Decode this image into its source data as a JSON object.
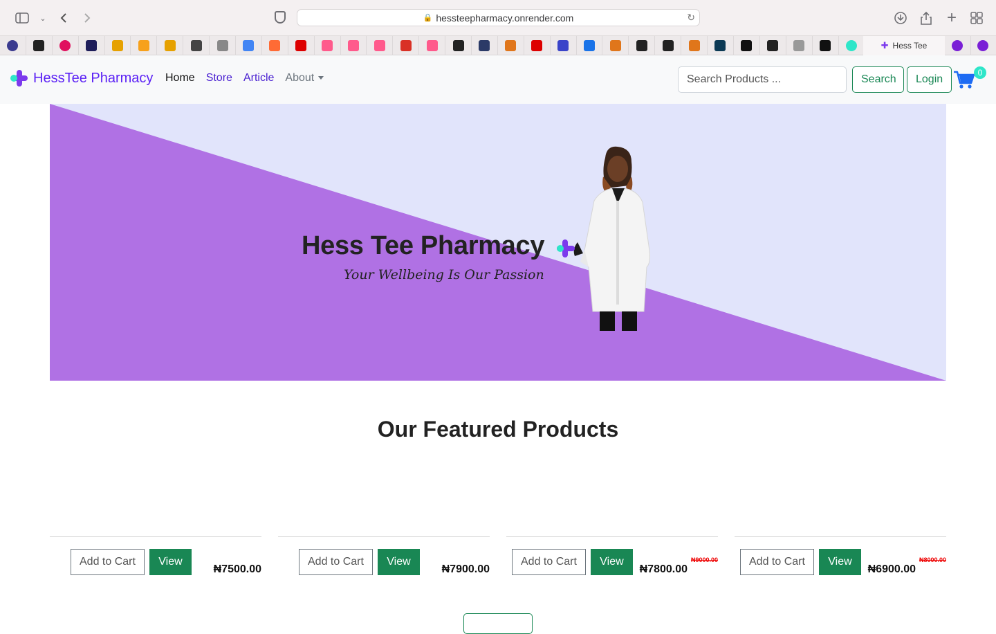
{
  "browser": {
    "url": "hessteepharmacy.onrender.com",
    "active_tab_title": "Hess Tee",
    "bookmark_count": 33
  },
  "navbar": {
    "brand": "HessTee Pharmacy",
    "links": {
      "home": "Home",
      "store": "Store",
      "article": "Article",
      "about": "About"
    },
    "search_placeholder": "Search Products ...",
    "search_button": "Search",
    "login_button": "Login",
    "cart_count": "0"
  },
  "hero": {
    "title": "Hess Tee Pharmacy",
    "tagline": "Your Wellbeing Is Our Passion"
  },
  "featured": {
    "title": "Our Featured Products",
    "products": [
      {
        "add_label": "Add to Cart",
        "view_label": "View",
        "price": "₦7500.00",
        "old_price": ""
      },
      {
        "add_label": "Add to Cart",
        "view_label": "View",
        "price": "₦7900.00",
        "old_price": ""
      },
      {
        "add_label": "Add to Cart",
        "view_label": "View",
        "price": "₦7800.00",
        "old_price": "₦9000.00"
      },
      {
        "add_label": "Add to Cart",
        "view_label": "View",
        "price": "₦6900.00",
        "old_price": "₦8000.00"
      }
    ]
  },
  "colors": {
    "brand_purple": "#5b21f5",
    "hero_purple": "#b071e4",
    "hero_lavender": "#e1e4fb",
    "green": "#198754",
    "teal": "#2ee6c9"
  }
}
